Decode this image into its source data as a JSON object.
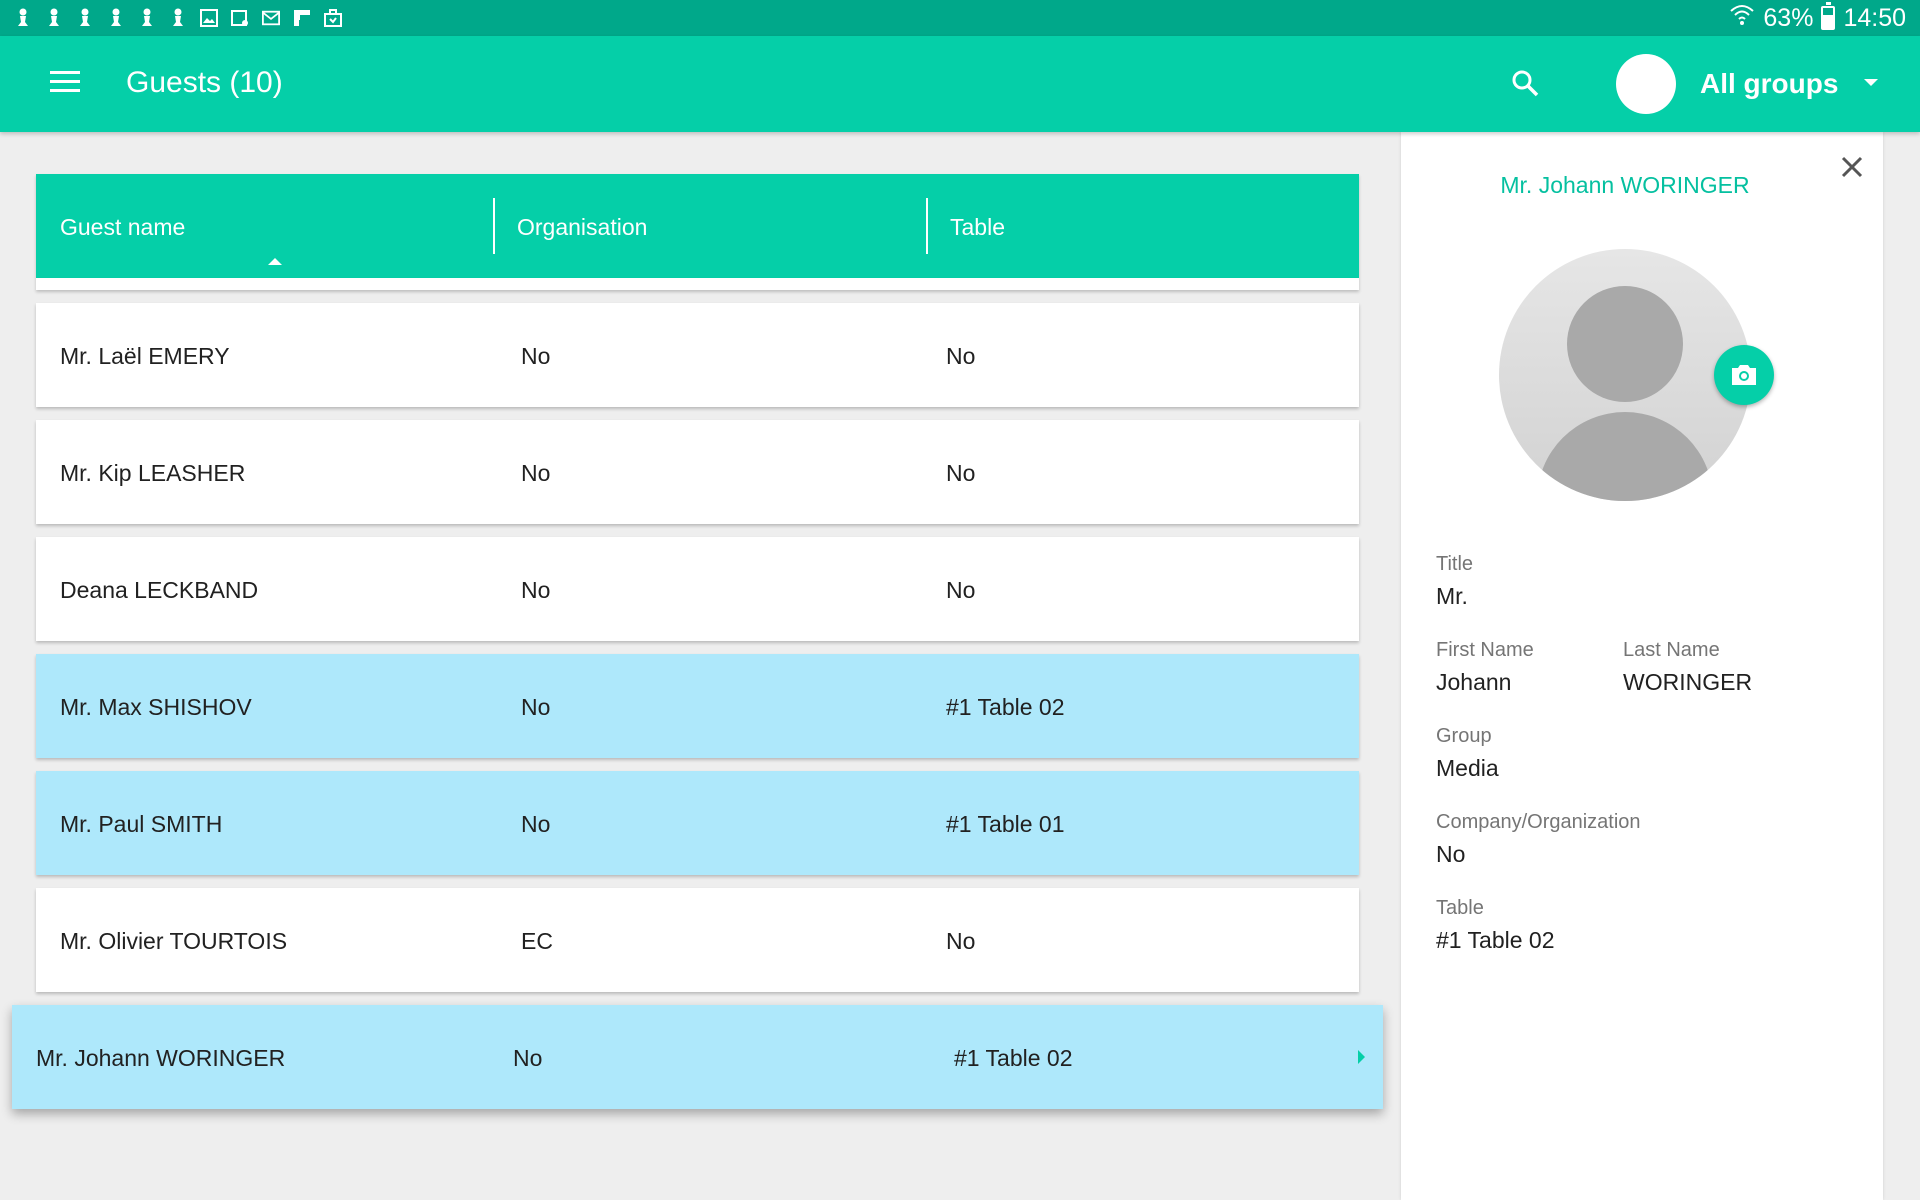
{
  "status_bar": {
    "battery": "63%",
    "battery_level": 0.63,
    "time": "14:50",
    "notification_icons": [
      "chess-pawn-icon",
      "chess-pawn-icon",
      "chess-pawn-icon",
      "chess-pawn-icon",
      "chess-pawn-icon",
      "chess-pawn-icon",
      "image-icon",
      "calendar-icon",
      "mail-icon",
      "flipboard-icon",
      "briefcase-icon"
    ]
  },
  "app_bar": {
    "title": "Guests (10)",
    "group_filter": "All groups"
  },
  "table": {
    "columns": [
      "Guest name",
      "Organisation",
      "Table"
    ],
    "rows": [
      {
        "name": "Mr. Laël EMERY",
        "organisation": "No",
        "table": "No",
        "highlighted": false
      },
      {
        "name": "Mr. Kip LEASHER",
        "organisation": "No",
        "table": "No",
        "highlighted": false
      },
      {
        "name": "Deana LECKBAND",
        "organisation": "No",
        "table": "No",
        "highlighted": false
      },
      {
        "name": "Mr. Max SHISHOV",
        "organisation": "No",
        "table": "#1 Table 02",
        "highlighted": true
      },
      {
        "name": "Mr. Paul SMITH",
        "organisation": "No",
        "table": "#1 Table 01",
        "highlighted": true
      },
      {
        "name": "Mr. Olivier TOURTOIS",
        "organisation": "EC",
        "table": "No",
        "highlighted": false
      },
      {
        "name": "Mr. Johann WORINGER",
        "organisation": "No",
        "table": "#1 Table 02",
        "highlighted": true
      }
    ]
  },
  "detail": {
    "name": "Mr. Johann WORINGER",
    "title_label": "Title",
    "title_value": "Mr.",
    "first_name_label": "First Name",
    "first_name_value": "Johann",
    "last_name_label": "Last Name",
    "last_name_value": "WORINGER",
    "group_label": "Group",
    "group_value": "Media",
    "company_label": "Company/Organization",
    "company_value": "No",
    "table_label": "Table",
    "table_value": "#1 Table 02"
  },
  "colors": {
    "status_bar": "#00a88a",
    "accent": "#05cfa8",
    "row_highlight": "#aee8fb",
    "accent_text": "#05c0a0"
  }
}
